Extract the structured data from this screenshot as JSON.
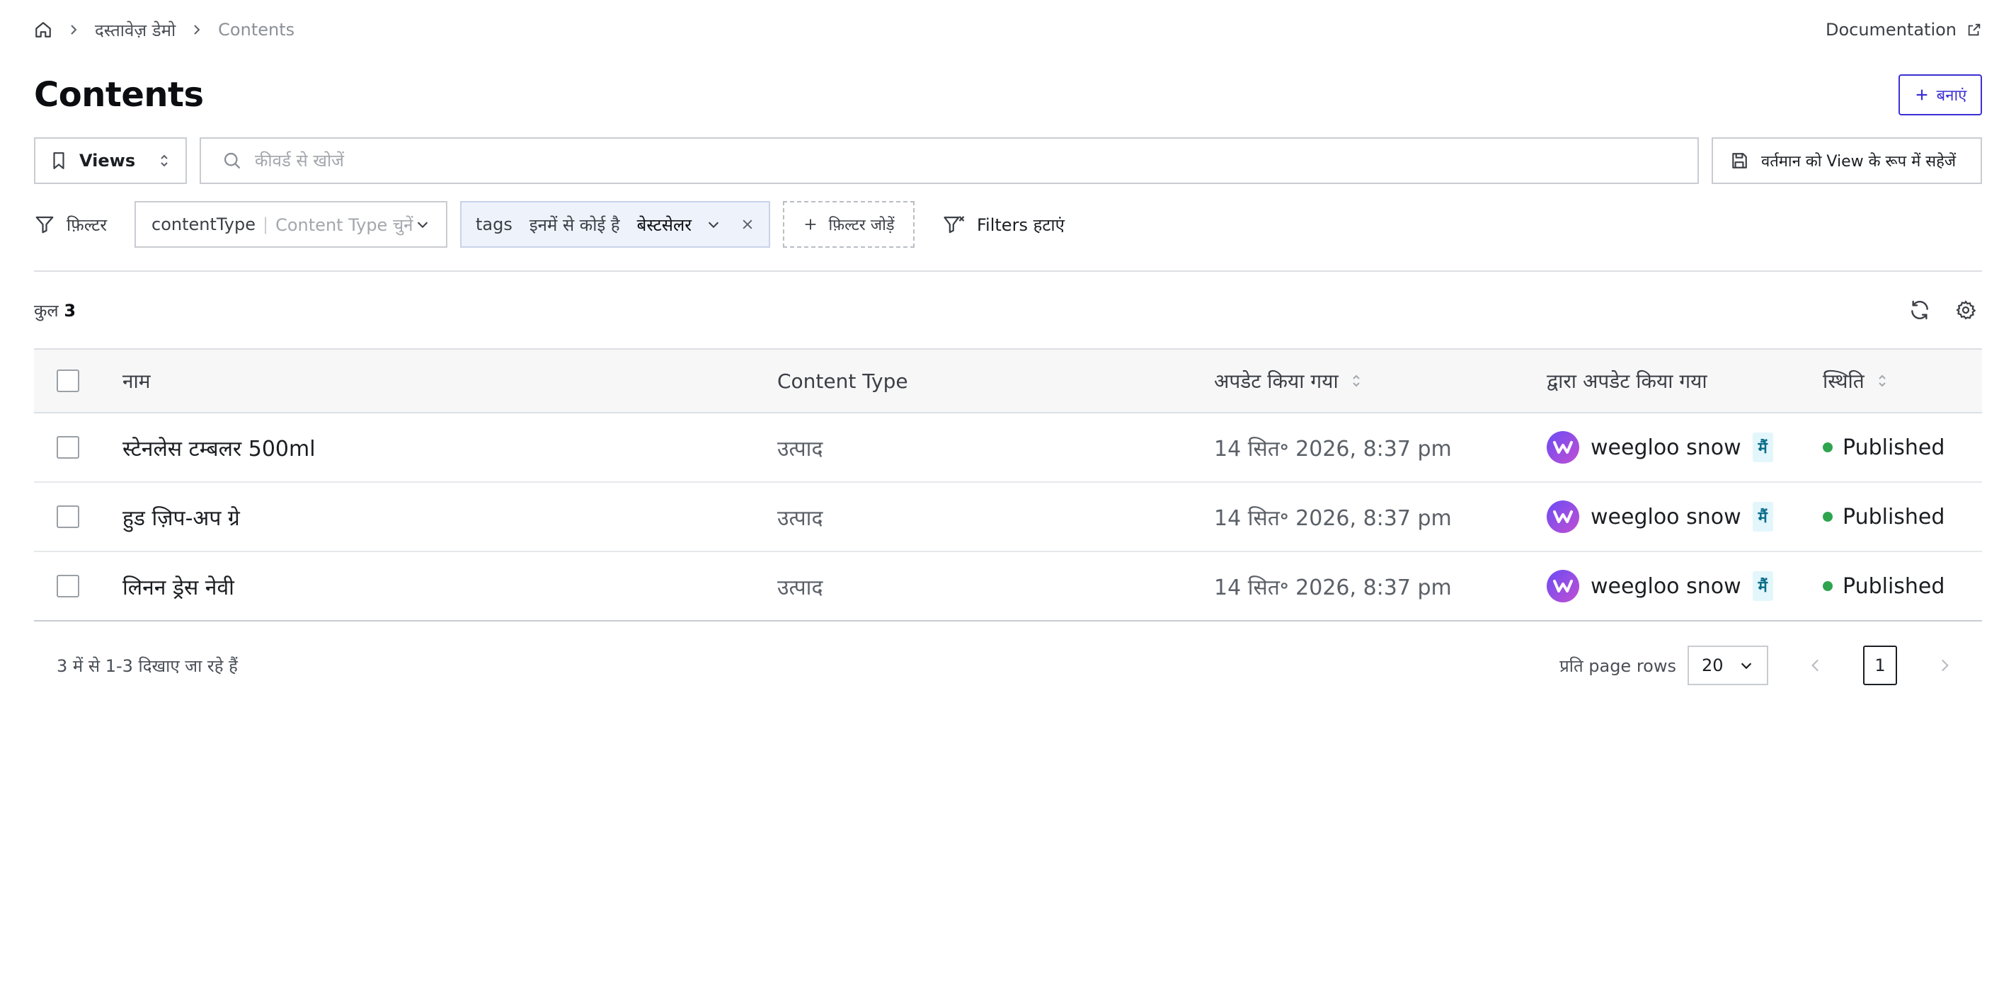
{
  "breadcrumb": {
    "home_icon": "home-icon",
    "items": [
      "दस्तावेज़ डेमो",
      "Contents"
    ]
  },
  "header": {
    "documentation_label": "Documentation",
    "title": "Contents",
    "create_label": "बनाएं"
  },
  "toolbar": {
    "views_label": "Views",
    "search_placeholder": "कीवर्ड से खोजें",
    "search_value": "",
    "save_view_label": "वर्तमान को View के रूप में सहेजें"
  },
  "filters": {
    "label": "फ़िल्टर",
    "content_type": {
      "key": "contentType",
      "placeholder": "Content Type चुनें"
    },
    "tags": {
      "key": "tags",
      "operator": "इनमें से कोई है",
      "value": "बेस्टसेलर"
    },
    "add_label": "फ़िल्टर जोड़ें",
    "remove_label": "Filters हटाएं"
  },
  "summary": {
    "count_label": "कुल",
    "count": "3"
  },
  "table": {
    "columns": {
      "name": "नाम",
      "content_type": "Content Type",
      "updated": "अपडेट किया गया",
      "updated_by": "द्वारा अपडेट किया गया",
      "status": "स्थिति"
    },
    "rows": [
      {
        "name": "स्टेनलेस टम्बलर 500ml",
        "content_type": "उत्पाद",
        "updated": "14 सित॰ 2026, 8:37 pm",
        "user": "weegloo snow",
        "me": "मैं",
        "status": "Published"
      },
      {
        "name": "हुड ज़िप-अप ग्रे",
        "content_type": "उत्पाद",
        "updated": "14 सित॰ 2026, 8:37 pm",
        "user": "weegloo snow",
        "me": "मैं",
        "status": "Published"
      },
      {
        "name": "लिनन ड्रेस नेवी",
        "content_type": "उत्पाद",
        "updated": "14 सित॰ 2026, 8:37 pm",
        "user": "weegloo snow",
        "me": "मैं",
        "status": "Published"
      }
    ]
  },
  "pagination": {
    "info": "3 में से 1-3 दिखाए जा रहे हैं",
    "rows_label": "प्रति page rows",
    "rows_value": "20",
    "current_page": "1"
  },
  "colors": {
    "accent": "#3b2fd6",
    "published": "#2ea44f",
    "me_badge_bg": "#e3f6fb"
  }
}
